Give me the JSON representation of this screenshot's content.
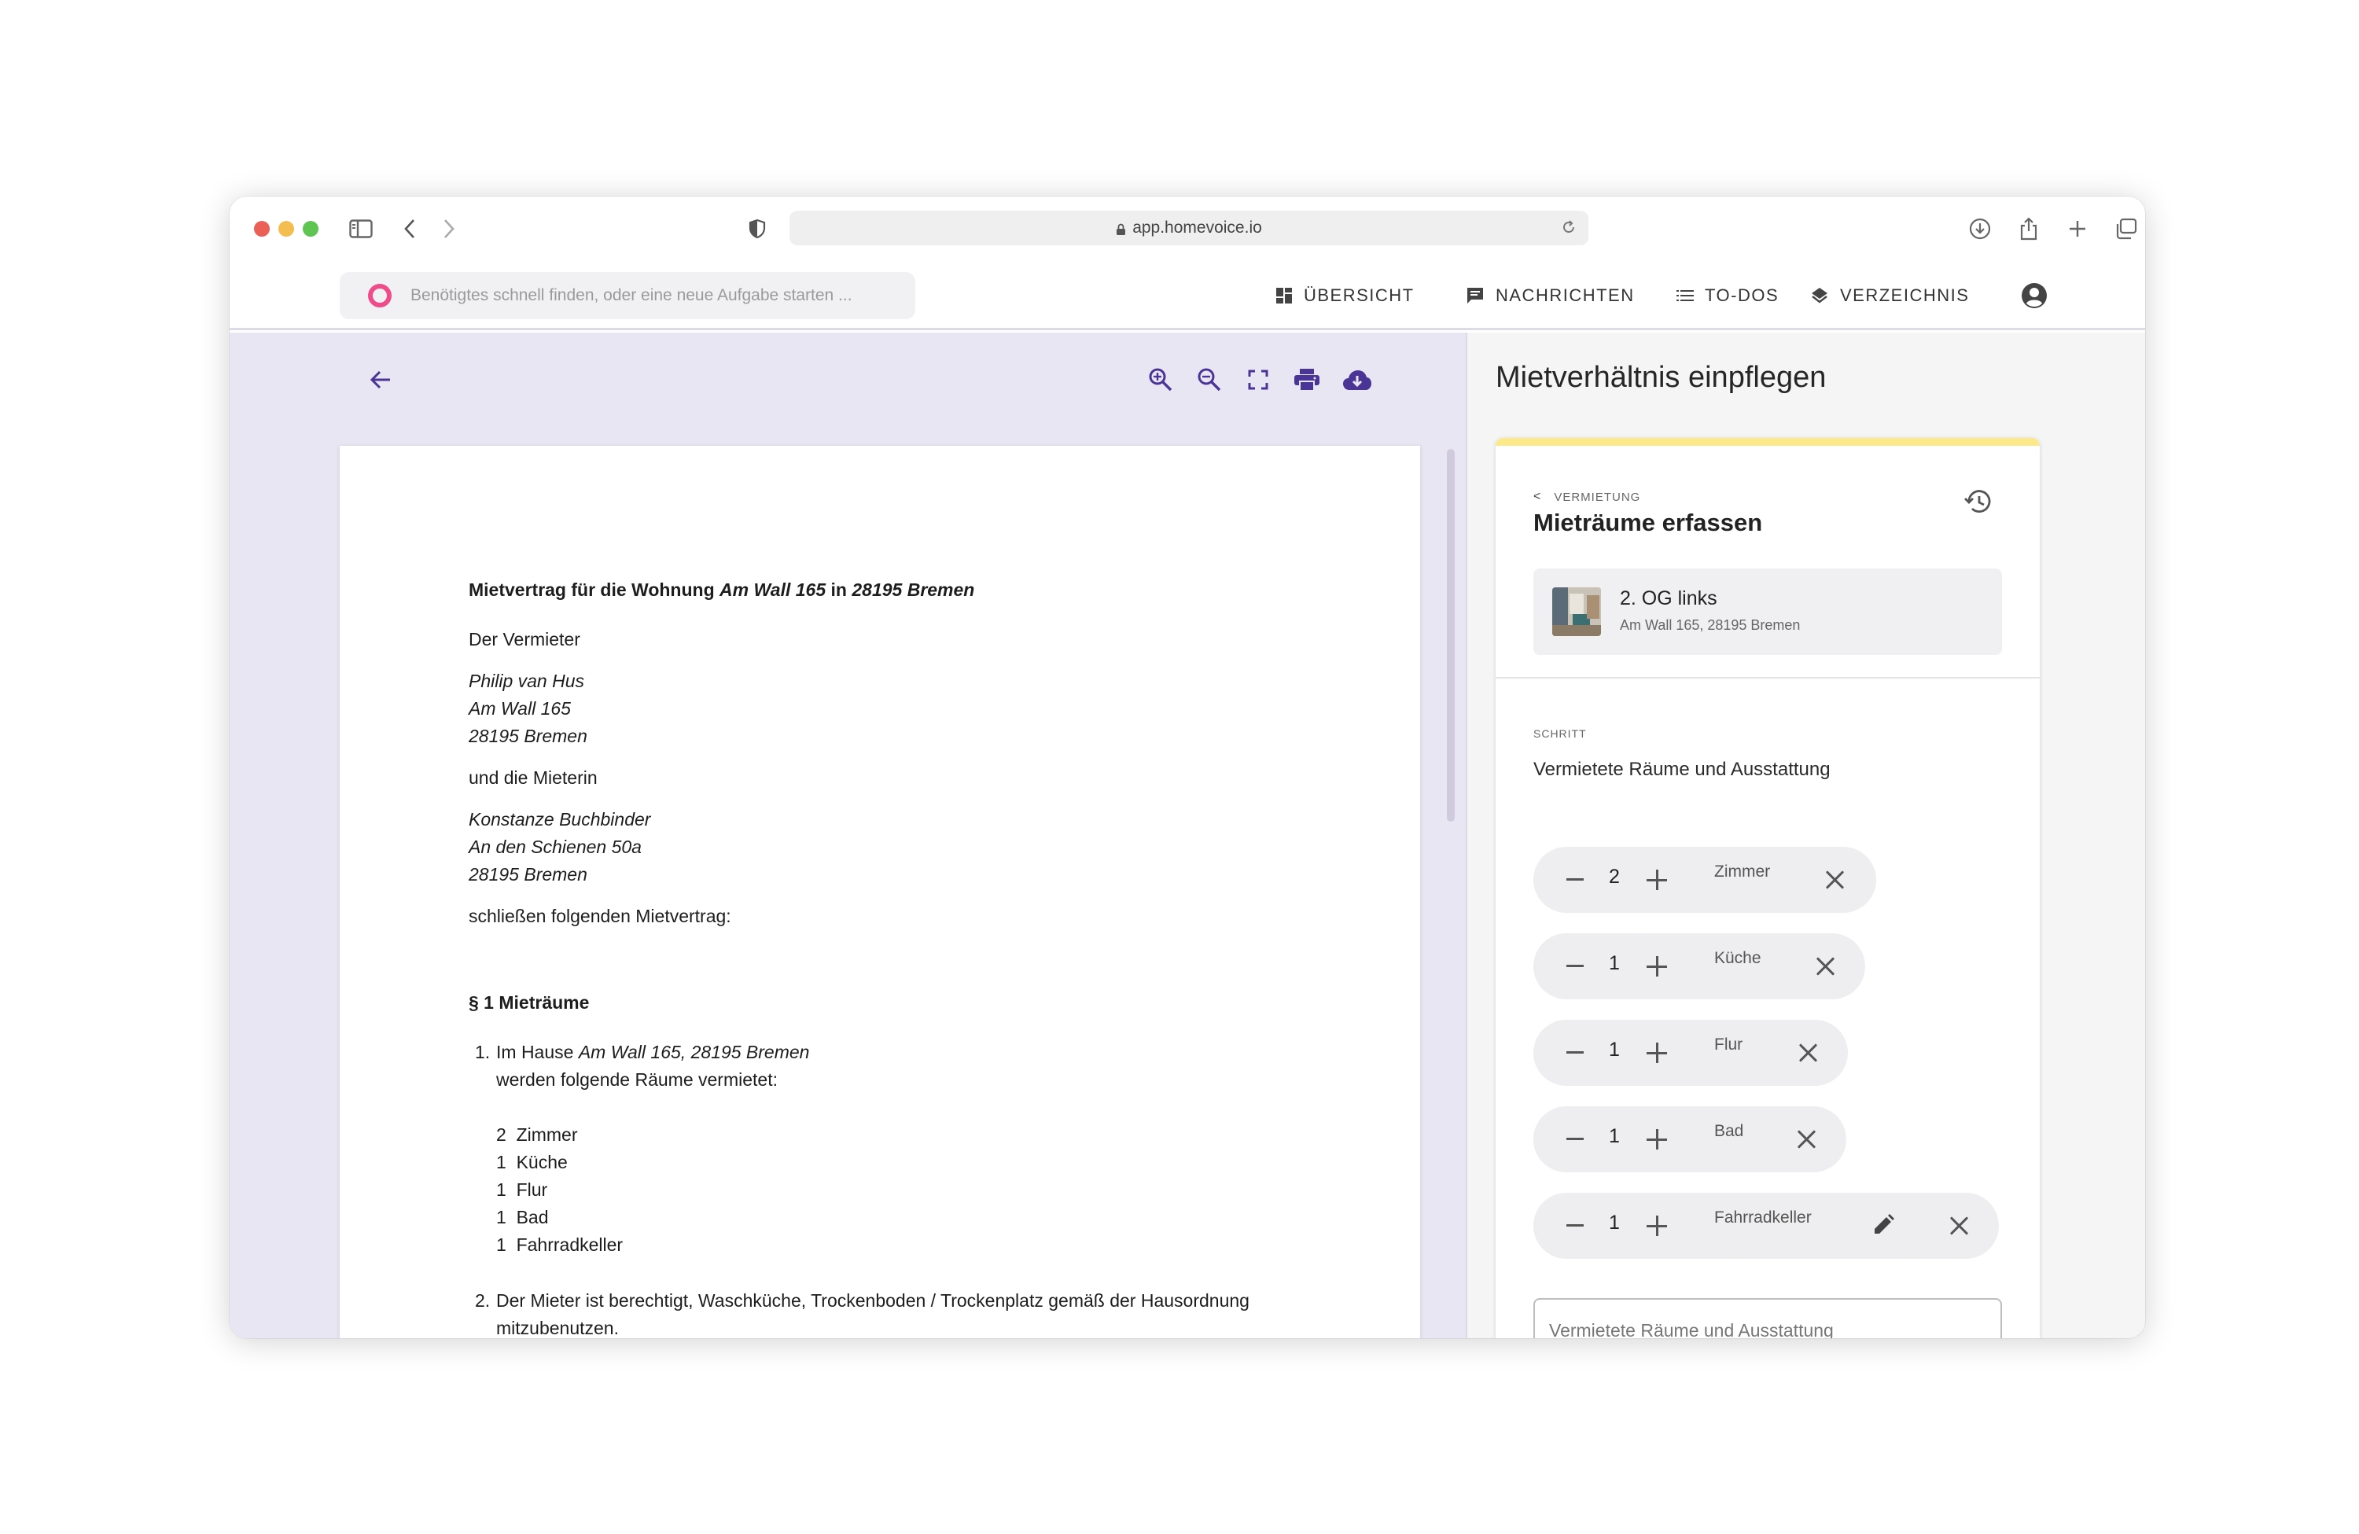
{
  "browser": {
    "url": "app.homevoice.io"
  },
  "header": {
    "search_placeholder": "Benötigtes schnell finden, oder eine neue Aufgabe starten ...",
    "nav": [
      {
        "label": "ÜBERSICHT",
        "icon": "dashboard-icon"
      },
      {
        "label": "NACHRICHTEN",
        "icon": "message-icon"
      },
      {
        "label": "TO-DOS",
        "icon": "list-icon"
      },
      {
        "label": "VERZEICHNIS",
        "icon": "layers-icon"
      }
    ],
    "account_icon": "account-circle-icon",
    "accent_color": "#ee4c8b"
  },
  "document": {
    "title_prefix": "Mietvertrag für die Wohnung ",
    "title_address": "Am Wall 165",
    "title_mid": " in ",
    "title_city": "28195 Bremen",
    "landlord_intro": "Der Vermieter",
    "landlord": [
      "Philip van Hus",
      "Am Wall 165",
      "28195 Bremen"
    ],
    "tenant_intro": "und die Mieterin",
    "tenant": [
      "Konstanze Buchbinder",
      "An den Schienen 50a",
      "28195 Bremen"
    ],
    "closing": "schließen folgenden Mietvertrag:",
    "section_title": "§ 1 Mieträume",
    "item1_num": "1.",
    "item1_prefix": "Im Hause ",
    "item1_address": "Am Wall 165, 28195 Bremen",
    "item1_line2": "werden folgende Räume vermietet:",
    "rooms": [
      {
        "count": "2",
        "name": "Zimmer"
      },
      {
        "count": "1",
        "name": "Küche"
      },
      {
        "count": "1",
        "name": "Flur"
      },
      {
        "count": "1",
        "name": "Bad"
      },
      {
        "count": "1",
        "name": "Fahrradkeller"
      }
    ],
    "item2_num": "2.",
    "item2_line1": "Der Mieter ist berechtigt, Waschküche, Trockenboden / Trockenplatz gemäß der Hausordnung",
    "item2_line2": "mitzubenutzen."
  },
  "toolbar": {
    "icons": [
      "back-arrow-icon",
      "zoom-in-icon",
      "zoom-out-icon",
      "fullscreen-icon",
      "print-icon",
      "cloud-download-icon"
    ],
    "accent_color": "#4a3597"
  },
  "panel": {
    "title": "Mietverhältnis einpflegen",
    "breadcrumb": "VERMIETUNG",
    "heading": "Mieträume erfassen",
    "unit_name": "2. OG links",
    "unit_address": "Am Wall 165, 28195 Bremen",
    "step_label": "SCHRITT",
    "step_title": "Vermietete Räume und Ausstattung",
    "rooms": [
      {
        "count": "2",
        "label": "Zimmer",
        "editable": false
      },
      {
        "count": "1",
        "label": "Küche",
        "editable": false
      },
      {
        "count": "1",
        "label": "Flur",
        "editable": false
      },
      {
        "count": "1",
        "label": "Bad",
        "editable": false
      },
      {
        "count": "1",
        "label": "Fahrradkeller",
        "editable": true
      }
    ],
    "input_placeholder": "Vermietete Räume und Ausstattung",
    "highlight_color": "#fbe98a"
  }
}
